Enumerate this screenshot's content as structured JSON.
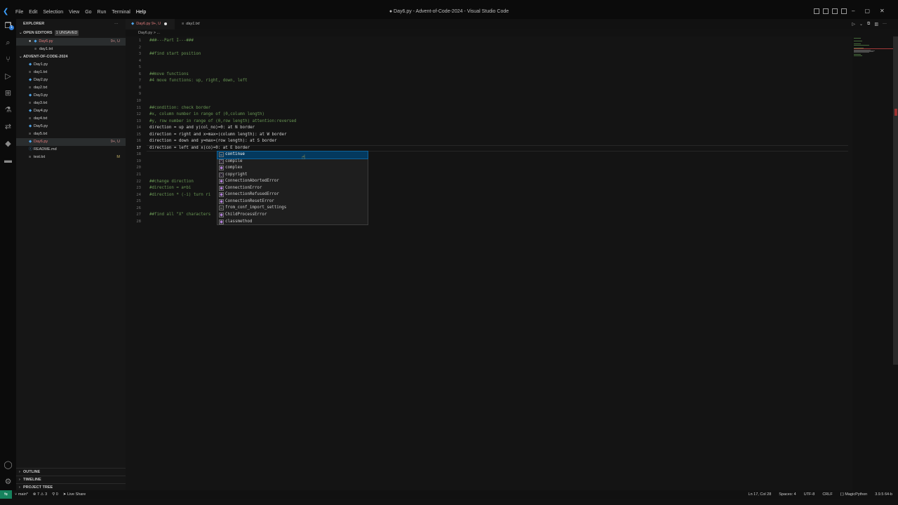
{
  "menu": [
    "File",
    "Edit",
    "Selection",
    "View",
    "Go",
    "Run",
    "Terminal",
    "Help"
  ],
  "window_title": "● Day6.py - Advent-of-Code-2024 - Visual Studio Code",
  "sidebar": {
    "title": "EXPLORER",
    "open_editors_label": "OPEN EDITORS",
    "unsaved_badge": "1 unsaved",
    "open_editors": [
      {
        "name": "Day6.py",
        "status": "9+, U"
      },
      {
        "name": "day1.txt",
        "status": ""
      }
    ],
    "project": "ADVENT-OF-CODE-2024",
    "files": [
      {
        "name": "Day1.py",
        "type": "py",
        "status": ""
      },
      {
        "name": "day1.txt",
        "type": "txt",
        "status": ""
      },
      {
        "name": "Day2.py",
        "type": "py",
        "status": ""
      },
      {
        "name": "day2.txt",
        "type": "txt",
        "status": ""
      },
      {
        "name": "Day3.py",
        "type": "py",
        "status": ""
      },
      {
        "name": "day3.txt",
        "type": "txt",
        "status": ""
      },
      {
        "name": "Day4.py",
        "type": "py",
        "status": ""
      },
      {
        "name": "day4.txt",
        "type": "txt",
        "status": ""
      },
      {
        "name": "Day5.py",
        "type": "py",
        "status": ""
      },
      {
        "name": "day5.txt",
        "type": "txt",
        "status": ""
      },
      {
        "name": "Day6.py",
        "type": "py",
        "status": "9+, U"
      },
      {
        "name": "README.md",
        "type": "md",
        "status": ""
      },
      {
        "name": "test.txt",
        "type": "txt",
        "status": "M"
      }
    ],
    "panels": [
      "OUTLINE",
      "TIMELINE",
      "PROJECT TREE"
    ]
  },
  "tabs": [
    {
      "label": "Day6.py 9+, U"
    },
    {
      "label": "day1.txt"
    }
  ],
  "breadcrumb": "Day6.py > ...",
  "code_lines": [
    {
      "n": "1",
      "text": "###---Part I---###",
      "kind": "cm"
    },
    {
      "n": "2",
      "text": "",
      "kind": ""
    },
    {
      "n": "3",
      "text": "##find start position",
      "kind": "cm"
    },
    {
      "n": "4",
      "text": "",
      "kind": ""
    },
    {
      "n": "5",
      "text": "",
      "kind": ""
    },
    {
      "n": "6",
      "text": "##move functions",
      "kind": "cm"
    },
    {
      "n": "7",
      "text": "#4 move functions: up, right, down, left",
      "kind": "cm"
    },
    {
      "n": "8",
      "text": "",
      "kind": ""
    },
    {
      "n": "9",
      "text": "",
      "kind": ""
    },
    {
      "n": "10",
      "text": "",
      "kind": ""
    },
    {
      "n": "11",
      "text": "##condition: check border",
      "kind": "cm"
    },
    {
      "n": "12",
      "text": "#x, column number in range of (0,column length)",
      "kind": "cm"
    },
    {
      "n": "13",
      "text": "#y, row number in range of (0,row length) attention:reversed",
      "kind": "cm"
    },
    {
      "n": "14",
      "text": "direction = up and y(col_no)=0: at N border",
      "kind": ""
    },
    {
      "n": "15",
      "text": "direction = right and x=max=(column length): at W border",
      "kind": ""
    },
    {
      "n": "16",
      "text": "direction = down and y=max=(row length): at S border",
      "kind": ""
    },
    {
      "n": "17",
      "text": "direction = left and x(co)=0: at E border",
      "kind": "",
      "current": true
    },
    {
      "n": "18",
      "text": "",
      "kind": ""
    },
    {
      "n": "19",
      "text": "",
      "kind": ""
    },
    {
      "n": "20",
      "text": "",
      "kind": ""
    },
    {
      "n": "21",
      "text": "",
      "kind": ""
    },
    {
      "n": "22",
      "text": "##change direction",
      "kind": "cm"
    },
    {
      "n": "23",
      "text": "#direction = a+bi",
      "kind": "cm"
    },
    {
      "n": "24",
      "text": "#direction * (-i) turn ri",
      "kind": "cm"
    },
    {
      "n": "25",
      "text": "",
      "kind": ""
    },
    {
      "n": "26",
      "text": "",
      "kind": ""
    },
    {
      "n": "27",
      "text": "##find all \"X\" characters",
      "kind": "cm"
    },
    {
      "n": "28",
      "text": "",
      "kind": ""
    }
  ],
  "suggestions": [
    {
      "label": "continue",
      "kind": "keyword"
    },
    {
      "label": "compile",
      "kind": "function"
    },
    {
      "label": "complex",
      "kind": "class"
    },
    {
      "label": "copyright",
      "kind": "variable"
    },
    {
      "label": "ConnectionAbortedError",
      "kind": "class"
    },
    {
      "label": "ConnectionError",
      "kind": "class"
    },
    {
      "label": "ConnectionRefusedError",
      "kind": "class"
    },
    {
      "label": "ConnectionResetError",
      "kind": "class"
    },
    {
      "label": "from_conf_import_settings",
      "kind": "snippet"
    },
    {
      "label": "ChildProcessError",
      "kind": "class"
    },
    {
      "label": "classmethod",
      "kind": "class"
    }
  ],
  "statusbar": {
    "branch": "main*",
    "problems": "⊗ 7 ⚠ 3",
    "ports": "⚲ 0",
    "live_share": "Live Share",
    "position": "Ln 17, Col 28",
    "spaces": "Spaces: 4",
    "encoding": "UTF-8",
    "eol": "CRLF",
    "language": "MagicPython",
    "interpreter": "3.9.5 64-b"
  },
  "colors": {
    "accent": "#0e639c",
    "remote": "#16825d",
    "modified_file": "#e07b7b",
    "comment": "#6a9955"
  }
}
